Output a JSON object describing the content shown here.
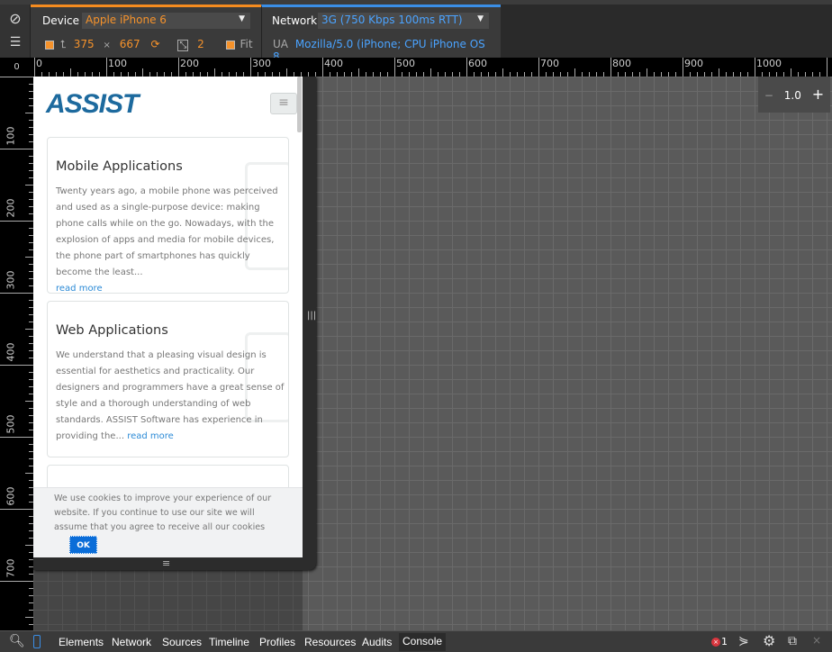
{
  "toolbar": {
    "device_label": "Device",
    "device_value": "Apple iPhone 6",
    "width": "375",
    "times": "×",
    "height": "667",
    "pixel_ratio": "2",
    "fit_label": "Fit",
    "fit_checked": true,
    "emulate_resolution_checked": true,
    "network_label": "Network",
    "network_value": "3G (750 Kbps 100ms RTT)",
    "ua_label": "UA",
    "ua_value": "Mozilla/5.0 (iPhone; CPU iPhone OS 8_...",
    "accent_device": "#f58b1f",
    "accent_network": "#3a8ee6"
  },
  "ruler": {
    "h_labels": [
      "0",
      "100",
      "200",
      "300",
      "400",
      "500",
      "600",
      "700",
      "800",
      "900",
      "1000"
    ],
    "v_labels": [
      "100",
      "200",
      "300",
      "400",
      "500",
      "600",
      "700"
    ],
    "corner": "0"
  },
  "zoom": {
    "minus": "−",
    "value": "1.0",
    "plus": "+"
  },
  "page": {
    "logo": "ASSIST",
    "cards": [
      {
        "title": "Mobile Applications",
        "body": "Twenty years ago, a mobile phone was perceived and used as a single-purpose device: making phone calls while on the go. Nowadays, with the explosion of apps and media for mobile devices, the phone part of smartphones has quickly become the least...",
        "link": "read more"
      },
      {
        "title": "Web Applications",
        "body": "We understand that a pleasing visual design is essential for aesthetics and practicality. Our designers and programmers have a great sense of style and a thorough understanding of web standards. ASSIST Software has experience in providing the...",
        "link": "read more"
      }
    ],
    "cookie_text": "We use cookies to improve your experience of our website. If you continue to use our site we will assume that you agree to receive all our cookies",
    "cookie_ok": "OK"
  },
  "bottom": {
    "tabs": [
      "Elements",
      "Network",
      "Sources",
      "Timeline",
      "Profiles",
      "Resources",
      "Audits",
      "Console"
    ],
    "active_tab": "Console",
    "error_count": "1"
  }
}
